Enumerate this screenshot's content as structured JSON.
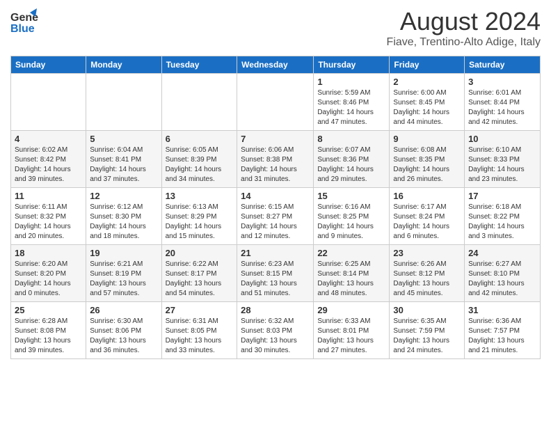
{
  "header": {
    "logo": {
      "general": "General",
      "blue": "Blue"
    },
    "title": "August 2024",
    "subtitle": "Fiave, Trentino-Alto Adige, Italy"
  },
  "weekdays": [
    "Sunday",
    "Monday",
    "Tuesday",
    "Wednesday",
    "Thursday",
    "Friday",
    "Saturday"
  ],
  "weeks": [
    [
      {
        "day": "",
        "info": ""
      },
      {
        "day": "",
        "info": ""
      },
      {
        "day": "",
        "info": ""
      },
      {
        "day": "",
        "info": ""
      },
      {
        "day": "1",
        "info": "Sunrise: 5:59 AM\nSunset: 8:46 PM\nDaylight: 14 hours and 47 minutes."
      },
      {
        "day": "2",
        "info": "Sunrise: 6:00 AM\nSunset: 8:45 PM\nDaylight: 14 hours and 44 minutes."
      },
      {
        "day": "3",
        "info": "Sunrise: 6:01 AM\nSunset: 8:44 PM\nDaylight: 14 hours and 42 minutes."
      }
    ],
    [
      {
        "day": "4",
        "info": "Sunrise: 6:02 AM\nSunset: 8:42 PM\nDaylight: 14 hours and 39 minutes."
      },
      {
        "day": "5",
        "info": "Sunrise: 6:04 AM\nSunset: 8:41 PM\nDaylight: 14 hours and 37 minutes."
      },
      {
        "day": "6",
        "info": "Sunrise: 6:05 AM\nSunset: 8:39 PM\nDaylight: 14 hours and 34 minutes."
      },
      {
        "day": "7",
        "info": "Sunrise: 6:06 AM\nSunset: 8:38 PM\nDaylight: 14 hours and 31 minutes."
      },
      {
        "day": "8",
        "info": "Sunrise: 6:07 AM\nSunset: 8:36 PM\nDaylight: 14 hours and 29 minutes."
      },
      {
        "day": "9",
        "info": "Sunrise: 6:08 AM\nSunset: 8:35 PM\nDaylight: 14 hours and 26 minutes."
      },
      {
        "day": "10",
        "info": "Sunrise: 6:10 AM\nSunset: 8:33 PM\nDaylight: 14 hours and 23 minutes."
      }
    ],
    [
      {
        "day": "11",
        "info": "Sunrise: 6:11 AM\nSunset: 8:32 PM\nDaylight: 14 hours and 20 minutes."
      },
      {
        "day": "12",
        "info": "Sunrise: 6:12 AM\nSunset: 8:30 PM\nDaylight: 14 hours and 18 minutes."
      },
      {
        "day": "13",
        "info": "Sunrise: 6:13 AM\nSunset: 8:29 PM\nDaylight: 14 hours and 15 minutes."
      },
      {
        "day": "14",
        "info": "Sunrise: 6:15 AM\nSunset: 8:27 PM\nDaylight: 14 hours and 12 minutes."
      },
      {
        "day": "15",
        "info": "Sunrise: 6:16 AM\nSunset: 8:25 PM\nDaylight: 14 hours and 9 minutes."
      },
      {
        "day": "16",
        "info": "Sunrise: 6:17 AM\nSunset: 8:24 PM\nDaylight: 14 hours and 6 minutes."
      },
      {
        "day": "17",
        "info": "Sunrise: 6:18 AM\nSunset: 8:22 PM\nDaylight: 14 hours and 3 minutes."
      }
    ],
    [
      {
        "day": "18",
        "info": "Sunrise: 6:20 AM\nSunset: 8:20 PM\nDaylight: 14 hours and 0 minutes."
      },
      {
        "day": "19",
        "info": "Sunrise: 6:21 AM\nSunset: 8:19 PM\nDaylight: 13 hours and 57 minutes."
      },
      {
        "day": "20",
        "info": "Sunrise: 6:22 AM\nSunset: 8:17 PM\nDaylight: 13 hours and 54 minutes."
      },
      {
        "day": "21",
        "info": "Sunrise: 6:23 AM\nSunset: 8:15 PM\nDaylight: 13 hours and 51 minutes."
      },
      {
        "day": "22",
        "info": "Sunrise: 6:25 AM\nSunset: 8:14 PM\nDaylight: 13 hours and 48 minutes."
      },
      {
        "day": "23",
        "info": "Sunrise: 6:26 AM\nSunset: 8:12 PM\nDaylight: 13 hours and 45 minutes."
      },
      {
        "day": "24",
        "info": "Sunrise: 6:27 AM\nSunset: 8:10 PM\nDaylight: 13 hours and 42 minutes."
      }
    ],
    [
      {
        "day": "25",
        "info": "Sunrise: 6:28 AM\nSunset: 8:08 PM\nDaylight: 13 hours and 39 minutes."
      },
      {
        "day": "26",
        "info": "Sunrise: 6:30 AM\nSunset: 8:06 PM\nDaylight: 13 hours and 36 minutes."
      },
      {
        "day": "27",
        "info": "Sunrise: 6:31 AM\nSunset: 8:05 PM\nDaylight: 13 hours and 33 minutes."
      },
      {
        "day": "28",
        "info": "Sunrise: 6:32 AM\nSunset: 8:03 PM\nDaylight: 13 hours and 30 minutes."
      },
      {
        "day": "29",
        "info": "Sunrise: 6:33 AM\nSunset: 8:01 PM\nDaylight: 13 hours and 27 minutes."
      },
      {
        "day": "30",
        "info": "Sunrise: 6:35 AM\nSunset: 7:59 PM\nDaylight: 13 hours and 24 minutes."
      },
      {
        "day": "31",
        "info": "Sunrise: 6:36 AM\nSunset: 7:57 PM\nDaylight: 13 hours and 21 minutes."
      }
    ]
  ]
}
